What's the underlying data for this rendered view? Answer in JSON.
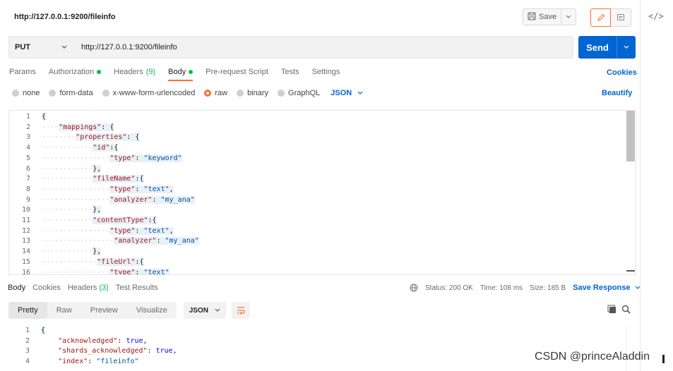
{
  "title": "http://127.0.0.1:9200/fileinfo",
  "toolbar": {
    "save_label": "Save"
  },
  "request": {
    "method": "PUT",
    "url": "http://127.0.0.1:9200/fileinfo",
    "send_label": "Send"
  },
  "tabs": [
    {
      "label": "Params"
    },
    {
      "label": "Authorization",
      "dot": true
    },
    {
      "label": "Headers",
      "count": "(9)"
    },
    {
      "label": "Body",
      "dot": true,
      "active": true
    },
    {
      "label": "Pre-request Script"
    },
    {
      "label": "Tests"
    },
    {
      "label": "Settings"
    }
  ],
  "cookies_label": "Cookies",
  "body_types": [
    {
      "label": "none"
    },
    {
      "label": "form-data"
    },
    {
      "label": "x-www-form-urlencoded"
    },
    {
      "label": "raw",
      "selected": true
    },
    {
      "label": "binary"
    },
    {
      "label": "GraphQL"
    }
  ],
  "body_format": "JSON",
  "beautify_label": "Beautify",
  "editor_lines": [
    {
      "n": "1",
      "indent": "",
      "text": "{"
    },
    {
      "n": "2",
      "indent": "····",
      "text": "\"mappings\": {"
    },
    {
      "n": "3",
      "indent": "········",
      "text": "\"properties\": {"
    },
    {
      "n": "4",
      "indent": "············",
      "text": "\"id\":{"
    },
    {
      "n": "5",
      "indent": "················",
      "text": "\"type\": \"keyword\""
    },
    {
      "n": "6",
      "indent": "············",
      "text": "},"
    },
    {
      "n": "7",
      "indent": "············",
      "text": "\"fileName\":{"
    },
    {
      "n": "8",
      "indent": "················",
      "text": "\"type\": \"text\","
    },
    {
      "n": "9",
      "indent": "················",
      "text": "\"analyzer\": \"my_ana\""
    },
    {
      "n": "10",
      "indent": "············",
      "text": "},"
    },
    {
      "n": "11",
      "indent": "············",
      "text": "\"contentType\":{"
    },
    {
      "n": "12",
      "indent": "················",
      "text": "\"type\": \"text\","
    },
    {
      "n": "13",
      "indent": "·················",
      "text": "\"analyzer\": \"my_ana\""
    },
    {
      "n": "14",
      "indent": "············",
      "text": "},"
    },
    {
      "n": "15",
      "indent": "·············",
      "text": "\"fileUrl\":{"
    },
    {
      "n": "16",
      "indent": "················",
      "text": "\"type\": \"text\""
    }
  ],
  "response_tabs": [
    {
      "label": "Body",
      "active": true
    },
    {
      "label": "Cookies"
    },
    {
      "label": "Headers",
      "count": "(3)"
    },
    {
      "label": "Test Results"
    }
  ],
  "status": {
    "status_text": "Status: 200 OK",
    "time_text": "Time: 108 ms",
    "size_text": "Size: 185 B",
    "save_response_label": "Save Response"
  },
  "response_views": [
    {
      "label": "Pretty",
      "active": true
    },
    {
      "label": "Raw"
    },
    {
      "label": "Preview"
    },
    {
      "label": "Visualize"
    }
  ],
  "response_format": "JSON",
  "response_lines": [
    {
      "n": "1",
      "indent": "",
      "text": "{"
    },
    {
      "n": "2",
      "indent": "    ",
      "key": "\"acknowledged\"",
      "val": "true",
      "vtype": "kw",
      "tail": ","
    },
    {
      "n": "3",
      "indent": "    ",
      "key": "\"shards_acknowledged\"",
      "val": "true",
      "vtype": "kw",
      "tail": ","
    },
    {
      "n": "4",
      "indent": "    ",
      "key": "\"index\"",
      "val": "\"fileinfo\"",
      "vtype": "str",
      "tail": ""
    }
  ],
  "watermark": "CSDN @princeAladdin",
  "colors": {
    "accent": "#ff6c37",
    "primary": "#0265d2",
    "success": "#0cbb52"
  }
}
